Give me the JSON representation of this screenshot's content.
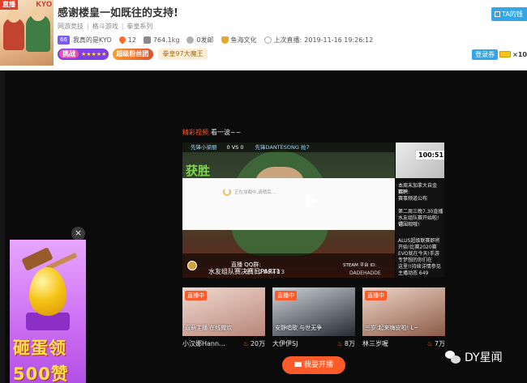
{
  "header": {
    "avatar": {
      "corner_tag": "直播",
      "name_tag": "KYO"
    },
    "title": "感谢楼皇一如既往的支持!",
    "breadcrumb": [
      "网游竞技",
      "格斗游戏",
      "拳皇系列"
    ],
    "level": "66",
    "streamer_name": "我真的是KYO",
    "fans": "12",
    "weight": "764.1kg",
    "followers": "0发邮",
    "guild": "鱼海文化",
    "last_live_label": "上次直播:",
    "last_live_time": "2019-11-16 19:26:12",
    "challenge_label": "挑战",
    "challenge_stars": "★★★★★",
    "super_badge": "超级粉丝团",
    "rank_badge": "拳皇97大魔王",
    "follow_label": "TA的钱",
    "login_label": "登录券",
    "login_count": "×10"
  },
  "featured": {
    "highlight": "精彩视频",
    "text": "看一波~~",
    "player": {
      "hud_left": "先锋小梁丽",
      "hud_score": "0  VS  0",
      "hud_right": "先锋DANTESONG  抢7",
      "watermark": "获胜",
      "loading_text": "正在加载中,请稍后...",
      "qq_label": "直播 QQ群:",
      "qq_number": "311289403",
      "steam": "STEAM 平台 ID:",
      "steam_id": "DADEHADDE",
      "stream_title": "水友组队赛决赛日PART1"
    },
    "thumb": {
      "duration": "100:51",
      "desc": [
        "本周末加拿大自金赛!",
        "招聘:",
        "赛事频道公布",
        "第二周三晚7.30直播",
        "水友组队赛开始啦!记",
        "得围观哦!",
        "ALUS超级联赛即将",
        "开始!比赛2020赛",
        "EVO就在今天!手游",
        "专梦想的你们在",
        "这里!!持续详情参见",
        "主播动态 649"
      ]
    }
  },
  "cards": [
    {
      "live": "直播中",
      "caption": "直萌主播 在线撒欢",
      "streamer": "小汉娜Hann...",
      "views": "20万",
      "colors": [
        "#f1d9cf",
        "#b88679"
      ]
    },
    {
      "live": "直播中",
      "caption": "安静唱歌 与世无争",
      "streamer": "大伊伊SJ",
      "views": "8万",
      "colors": [
        "#cfd3da",
        "#262a33"
      ]
    },
    {
      "live": "直播中",
      "caption": "三岁:起来嗨皮啦! L~",
      "streamer": "林三岁喔",
      "views": "7万",
      "colors": [
        "#f0d6c8",
        "#8c5a48"
      ]
    }
  ],
  "start_live": "我要开播",
  "egg_ad": {
    "title1": "砸蛋领",
    "title2": "500赞"
  },
  "watermark": "DY星闻",
  "colors": {
    "accent": "#ff5a2a",
    "blue": "#33a6e8",
    "purple": "#7b3fe4"
  }
}
